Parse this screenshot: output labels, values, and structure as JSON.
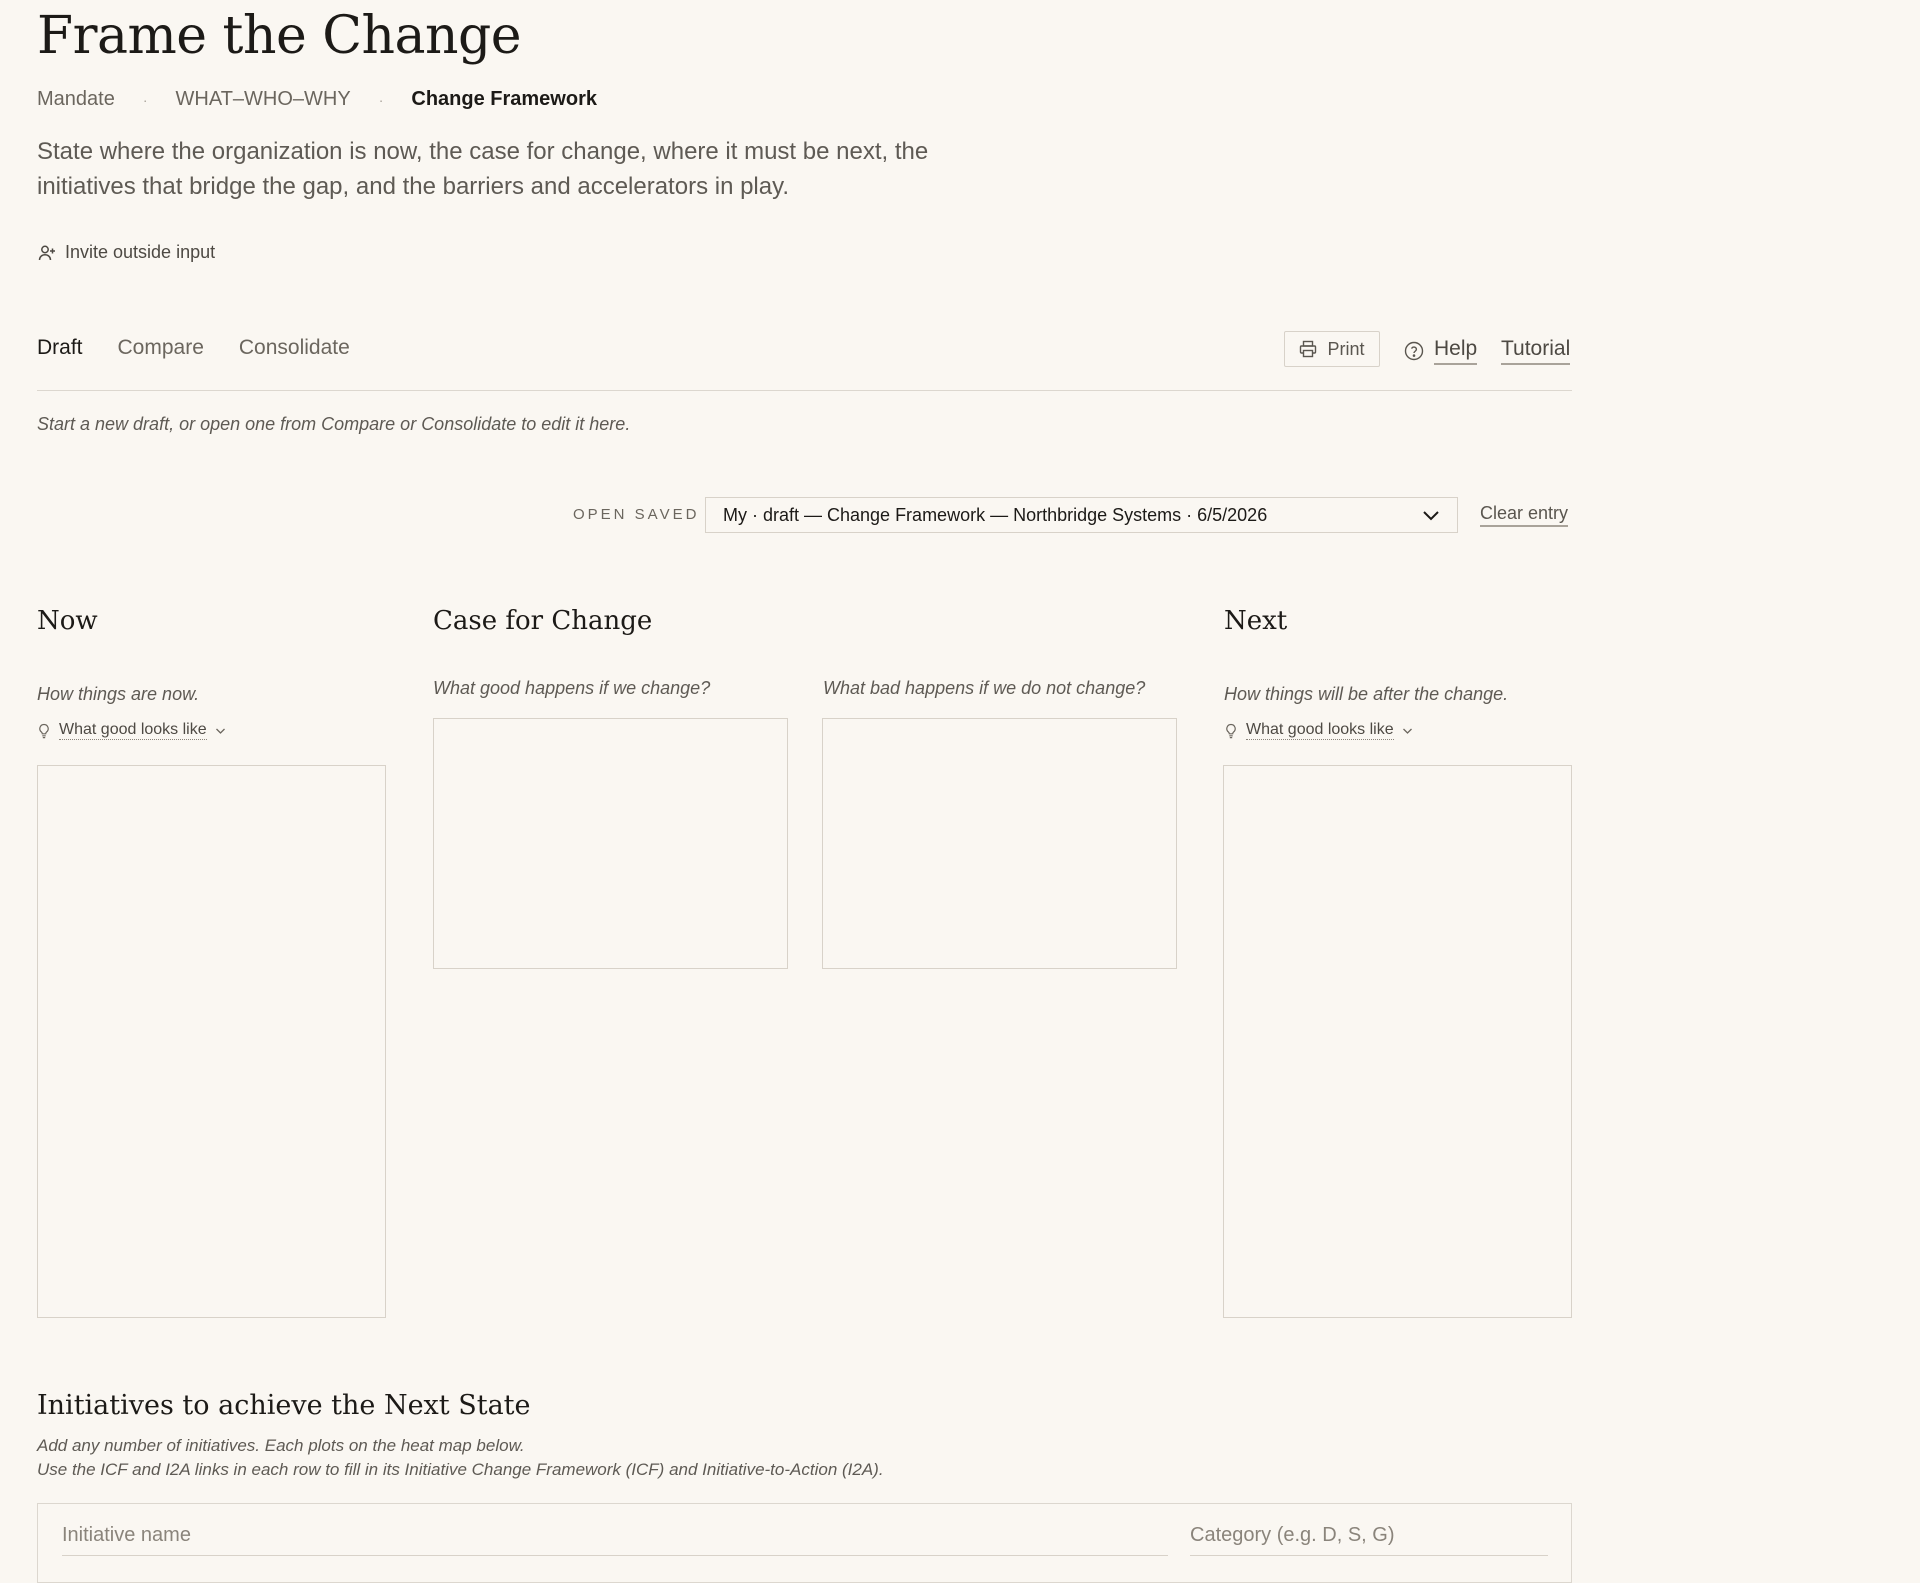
{
  "header": {
    "title": "Frame the Change",
    "breadcrumb": [
      "Mandate",
      "WHAT–WHO–WHY",
      "Change Framework"
    ],
    "intro": "State where the organization is now, the case for change, where it must be next, the initiatives that bridge the gap, and the barriers and accelerators in play.",
    "invite_label": "Invite outside input"
  },
  "tabs": [
    {
      "label": "Draft",
      "active": true
    },
    {
      "label": "Compare",
      "active": false
    },
    {
      "label": "Consolidate",
      "active": false
    }
  ],
  "toolbar": {
    "print_label": "Print",
    "help_label": "Help",
    "tutorial_label": "Tutorial"
  },
  "hint": "Start a new draft, or open one from Compare or Consolidate to edit it here.",
  "open_saved": {
    "label": "OPEN SAVED",
    "selected": "My · draft — Change Framework — Northbridge Systems · 6/5/2026",
    "clear_label": "Clear entry"
  },
  "columns": {
    "now": {
      "title": "Now",
      "prompt": "How things are now.",
      "good_link": "What good looks like"
    },
    "case": {
      "title": "Case for Change",
      "good_prompt": "What good happens if we change?",
      "bad_prompt": "What bad happens if we do not change?"
    },
    "next": {
      "title": "Next",
      "prompt": "How things will be after the change.",
      "good_link": "What good looks like"
    }
  },
  "initiatives": {
    "title": "Initiatives to achieve the Next State",
    "desc_line1": "Add any number of initiatives. Each plots on the heat map below.",
    "desc_line2": "Use the ICF and I2A links in each row to fill in its Initiative Change Framework (ICF) and Initiative-to-Action (I2A).",
    "name_placeholder": "Initiative name",
    "category_placeholder": "Category (e.g. D, S, G)"
  }
}
